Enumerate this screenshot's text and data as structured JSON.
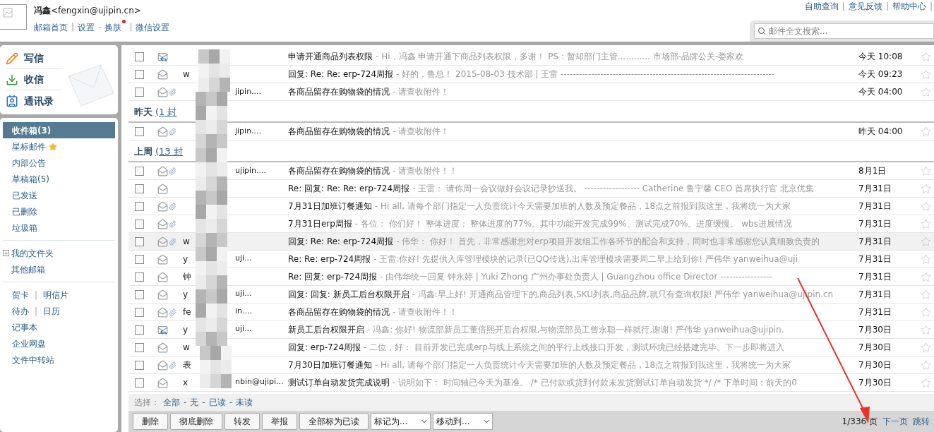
{
  "account": {
    "name_line": "**冯鑫**<fengxin@ujipin.cn>",
    "links": [
      {
        "label": "邮箱首页",
        "dot": false
      },
      {
        "label": "设置",
        "before": "|",
        "dot": false
      },
      {
        "label": "换肤",
        "before": "-",
        "dot": true
      },
      {
        "label": "微信设置",
        "before": "|",
        "dot": false
      }
    ]
  },
  "top_links": [
    {
      "label": "自助查询",
      "after": "|"
    },
    {
      "label": "意见反馈",
      "after": "|"
    },
    {
      "label": "帮助中心",
      "after": "|"
    }
  ],
  "search": {
    "placeholder": "邮件全文搜索..."
  },
  "quick_actions": [
    {
      "label": "写信",
      "kind": "compose"
    },
    {
      "label": "收信",
      "kind": "receive"
    },
    {
      "label": "通讯录",
      "kind": "contacts"
    }
  ],
  "folders": [
    {
      "label": "收件箱(3)",
      "selected": true,
      "kind": "plain"
    },
    {
      "label": "星标邮件",
      "selected": false,
      "kind": "starred"
    },
    {
      "label": "内部公告",
      "selected": false,
      "kind": "plain"
    },
    {
      "label": "草稿箱(5)",
      "selected": false,
      "kind": "plain"
    },
    {
      "label": "已发送",
      "selected": false,
      "kind": "plain"
    },
    {
      "label": "已删除",
      "selected": false,
      "kind": "plain"
    },
    {
      "label": "垃圾箱",
      "selected": false,
      "kind": "plain"
    }
  ],
  "my_folders": [
    {
      "label": "我的文件夹",
      "expanded": false,
      "kind": "tree"
    },
    {
      "label": "其他邮箱",
      "kind": "plain"
    }
  ],
  "tools": [
    {
      "items": [
        "贺卡",
        "明信片"
      ],
      "separator": "|"
    },
    {
      "items": [
        "待办",
        "日历"
      ],
      "separator": "|"
    },
    {
      "items": [
        "记事本"
      ]
    },
    {
      "items": [
        "企业网盘"
      ]
    },
    {
      "items": [
        "文件中转站"
      ]
    }
  ],
  "groups": [
    {
      "emails": [
        {
          "kind": "reply",
          "attachment": false,
          "checked": false,
          "highlighted": false,
          "starred": false,
          "subject": "申请开通商品列表权限",
          "preview": "- Hi，冯鑫 申请开通下商品列表权限，多谢！ PS：暂却部门主管............ 市场部-品牌公关-娄家欢",
          "date": "今天 10:08"
        },
        {
          "kind": "read",
          "attachment": false,
          "checked": false,
          "highlighted": false,
          "starred": false,
          "sender_left": "w",
          "subject": "回复:  Re:  Re:  erp-724周报",
          "preview": "- 好的，鲁总！ 2015-08-03 技术部 | 王雷 ----------------------------------------------------------------------",
          "date": "今天 09:23"
        },
        {
          "kind": "read",
          "attachment": true,
          "checked": false,
          "highlighted": false,
          "starred": false,
          "sender_right": "jipin....",
          "subject": "各商品留存在购物袋的情况",
          "preview": "- 请查收附件！",
          "date": "今天 04:00"
        }
      ]
    },
    {
      "title": "昨天",
      "count": "(1 封",
      "emails": [
        {
          "kind": "read",
          "attachment": true,
          "checked": false,
          "highlighted": false,
          "starred": false,
          "sender_right": "jipin....",
          "subject": "各商品留存在购物袋的情况",
          "preview": "- 请查收附件！",
          "date": "昨天 04:00"
        }
      ]
    },
    {
      "title": "上周",
      "count": "(13 封",
      "emails": [
        {
          "kind": "read",
          "attachment": true,
          "checked": false,
          "highlighted": false,
          "starred": false,
          "sender_right": "ujipin....",
          "subject": "各商品留存在购物袋的情况",
          "preview": "- 请查收附件！！",
          "date": "8月1日"
        },
        {
          "kind": "read",
          "attachment": false,
          "checked": false,
          "highlighted": false,
          "starred": false,
          "subject": "Re: 回复:  Re: Re:  erp-724周报",
          "preview": "- 王雷： 请你周一会议做好会议记录抄送我。 ------------------ Catherine 鲁宁馨 CEO 首席执行官 北京优集",
          "date": "7月31日"
        },
        {
          "kind": "read",
          "attachment": true,
          "checked": false,
          "highlighted": false,
          "starred": false,
          "subject": "7月31日加班订餐通知",
          "preview": "- Hi all, 请每个部门指定一人负责统计今天需要加班的人数及预定餐品，18点之前报到我这里，我将统一为大家",
          "date": "7月31日"
        },
        {
          "kind": "read",
          "attachment": true,
          "checked": false,
          "highlighted": false,
          "starred": false,
          "subject": "7月31日erp周报",
          "preview": "- 各位： 你们好！ 整体进度： 整体进度的77%。其中功能开发完成99%、测试完成70%。进度缓慢。 wbs进展情况",
          "date": "7月31日"
        },
        {
          "kind": "read",
          "attachment": true,
          "checked": false,
          "highlighted": true,
          "starred": false,
          "sender_left": "w",
          "subject": "回复:  Re: Re:  erp-724周报",
          "preview": "- 伟华： 你好！ 首先，非常感谢您对erp项目开发组工作各环节的配合和支持，同时也非常感谢您认真细致负责的",
          "date": "7月31日"
        },
        {
          "kind": "read",
          "attachment": false,
          "checked": false,
          "highlighted": false,
          "starred": false,
          "sender_left": "y",
          "sender_right": "uji...",
          "subject": "Re: Re:  erp-724周报",
          "preview": "- 王雷:你好! 先提供入库管理模块的记录(已QQ传送),出库管理模块需要周二早上给到你! 严伟华 yanweihua@uji",
          "date": "7月31日"
        },
        {
          "kind": "read",
          "attachment": false,
          "checked": false,
          "highlighted": false,
          "starred": false,
          "sender_left": "钟",
          "subject": "Re: 回复:  erp-724周报",
          "preview": "- 由伟华统一回复 钟永婷 | Yuki Zhong 广州办事处负责人 | Guangzhou office Director -----------------",
          "date": "7月31日"
        },
        {
          "kind": "read",
          "attachment": false,
          "checked": false,
          "highlighted": false,
          "starred": false,
          "sender_left": "y",
          "sender_right": "uji...",
          "subject": "回复: 回复: 新员工后台权限开启",
          "preview": "- 冯鑫:早上好! 开通商品管理下的,商品列表,SKU列表,商品品牌,就只有查询权限! 严伟华 yanweihua@ujipin.cn",
          "date": "7月31日"
        },
        {
          "kind": "read",
          "attachment": true,
          "checked": false,
          "highlighted": false,
          "starred": false,
          "sender_left": "fe",
          "sender_right": "in....",
          "subject": "各商品留存在购物袋的情况",
          "preview": "- 请查收附件！！",
          "date": "7月31日"
        },
        {
          "kind": "reply",
          "attachment": false,
          "checked": false,
          "highlighted": false,
          "starred": false,
          "sender_left": "y",
          "sender_right": "uji...",
          "subject": "新员工后台权限开启",
          "preview": "- 冯鑫: 你好! 物流部新员工董倍熙开后台权限,与物流部员工曾永聪一样就行,谢谢! 严伟华 yanweihua@ujipin.",
          "date": "7月30日"
        },
        {
          "kind": "read",
          "attachment": false,
          "checked": false,
          "highlighted": false,
          "starred": false,
          "sender_left": "w",
          "subject": "回复:  erp-724周报",
          "preview": "- 二位，好： 目前开发已完成erp与线上系统之间的平行上线接口开发，测试环境已经搭建完毕。下一步即将进入",
          "date": "7月30日"
        },
        {
          "kind": "read",
          "attachment": true,
          "checked": false,
          "highlighted": false,
          "starred": false,
          "sender_left": "表",
          "subject": "7月30日加班订餐通知",
          "preview": "- Hi all, 请每个部门指定一人负责统计今天需要加班的人数及预定餐品，18点之前报到我这里，我将统一为大家",
          "date": "7月30日"
        },
        {
          "kind": "read",
          "attachment": false,
          "checked": false,
          "highlighted": false,
          "starred": false,
          "sender_left": "x",
          "sender_right": "nbin@ujipi...",
          "subject": "测试订单自动发货完成说明",
          "preview": "- 说明如下： 时间轴已今天为基准。 /* 已付款或货到付款未发货测试订单自动发货 */ /* 下单时间：前天的0",
          "date": "7月30日"
        }
      ]
    }
  ],
  "select_bar": {
    "label": "选择：",
    "options": [
      "全部",
      "无",
      "已读",
      "未读"
    ],
    "separator": "-"
  },
  "toolbar": {
    "buttons": [
      "删除",
      "彻底删除",
      "转发",
      "举报",
      "全部标为已读"
    ],
    "dropdowns": [
      "标记为...",
      "移动到..."
    ]
  },
  "pagination": {
    "page": "1/336 页",
    "next": "下一页",
    "jump": "跳转"
  }
}
